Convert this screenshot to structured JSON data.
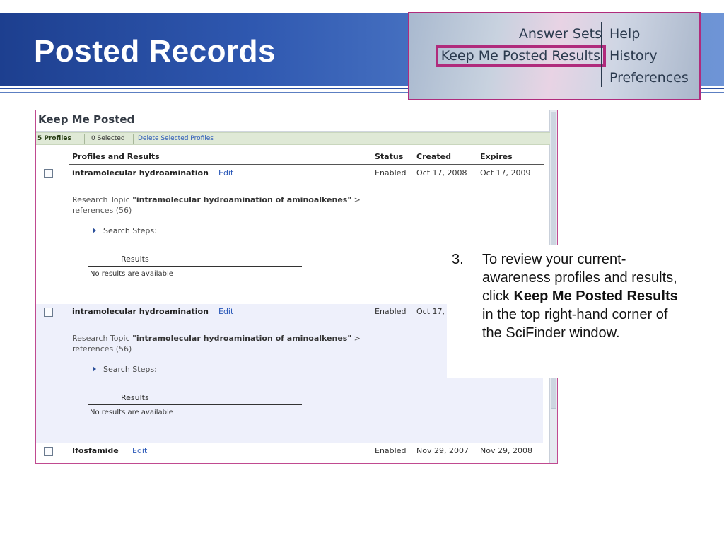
{
  "slide": {
    "title": "Posted Records"
  },
  "nav_inset": {
    "left_items": [
      "Answer Sets",
      "Keep Me Posted Results"
    ],
    "right_items": [
      "Help",
      "History",
      "Preferences"
    ]
  },
  "panel": {
    "title": "Keep Me Posted",
    "toolbar": {
      "count": "5 Profiles",
      "selected": "0 Selected",
      "delete_label": "Delete Selected Profiles"
    },
    "columns": {
      "profiles": "Profiles and Results",
      "status": "Status",
      "created": "Created",
      "expires": "Expires"
    },
    "profiles": [
      {
        "name": "intramolecular hydroamination",
        "edit": "Edit",
        "status": "Enabled",
        "created": "Oct 17, 2008",
        "expires": "Oct 17, 2009",
        "topic_prefix": "Research Topic ",
        "topic_query": "\"intramolecular hydroamination of aminoalkenes\"",
        "topic_suffix": " > references (56)",
        "search_steps": "Search Steps:",
        "results_label": "Results",
        "no_results": "No results are available"
      },
      {
        "name": "intramolecular hydroamination",
        "edit": "Edit",
        "status": "Enabled",
        "created": "Oct 17,",
        "expires": "",
        "topic_prefix": "Research Topic ",
        "topic_query": "\"intramolecular hydroamination of aminoalkenes\"",
        "topic_suffix": " > references (56)",
        "search_steps": "Search Steps:",
        "results_label": "Results",
        "no_results": "No results are available"
      },
      {
        "name": "Ifosfamide",
        "edit": "Edit",
        "status": "Enabled",
        "created": "Nov 29, 2007",
        "expires": "Nov 29, 2008"
      }
    ]
  },
  "callout": {
    "number": "3.",
    "text_before": "To review your current-awareness profiles and results, click ",
    "text_bold": "Keep Me Posted Results",
    "text_after": " in the top right-hand corner of the SciFinder window."
  },
  "colors": {
    "header_blue": "#2f58b0",
    "highlight_magenta": "#b02b7c",
    "link_blue": "#2a58b8"
  }
}
